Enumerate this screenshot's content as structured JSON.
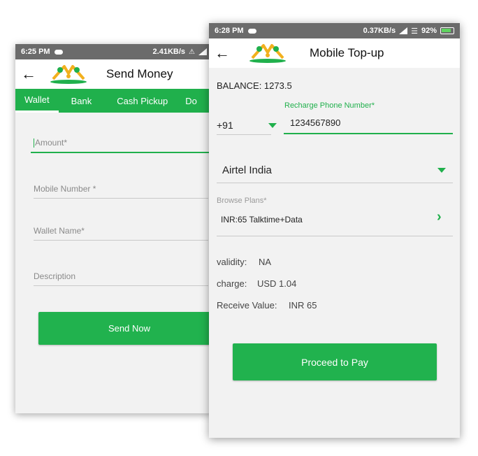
{
  "back_screen": {
    "status": {
      "time": "6:25 PM",
      "net_speed": "2.41KB/s"
    },
    "title": "Send Money",
    "tabs": [
      "Wallet",
      "Bank",
      "Cash Pickup",
      "Do"
    ],
    "fields": {
      "amount": "Amount*",
      "mobile": "Mobile Number *",
      "wallet_name": "Wallet Name*",
      "description": "Description"
    },
    "send_button": "Send Now"
  },
  "front_screen": {
    "status": {
      "time": "6:28 PM",
      "net_speed": "0.37KB/s",
      "battery": "92%"
    },
    "title": "Mobile Top-up",
    "balance": "BALANCE: 1273.5",
    "country_code": "+91",
    "phone_label": "Recharge Phone Number*",
    "phone_value": "1234567890",
    "operator": "Airtel India",
    "browse_label": "Browse Plans*",
    "plan": "INR:65 Talktime+Data",
    "details": {
      "validity_label": "validity:",
      "validity_value": "NA",
      "charge_label": "charge:",
      "charge_value": "USD 1.04",
      "receive_label": "Receive Value:",
      "receive_value": "INR 65"
    },
    "proceed_button": "Proceed to Pay"
  },
  "colors": {
    "accent": "#20b04c",
    "status_bar": "#6b6b6b",
    "background": "#f2f2f2"
  },
  "icons": [
    "back-arrow-icon",
    "app-logo",
    "cloud-icon",
    "wifi-icon",
    "signal-icon",
    "battery-icon",
    "chevron-right-icon",
    "dropdown-caret-icon"
  ]
}
